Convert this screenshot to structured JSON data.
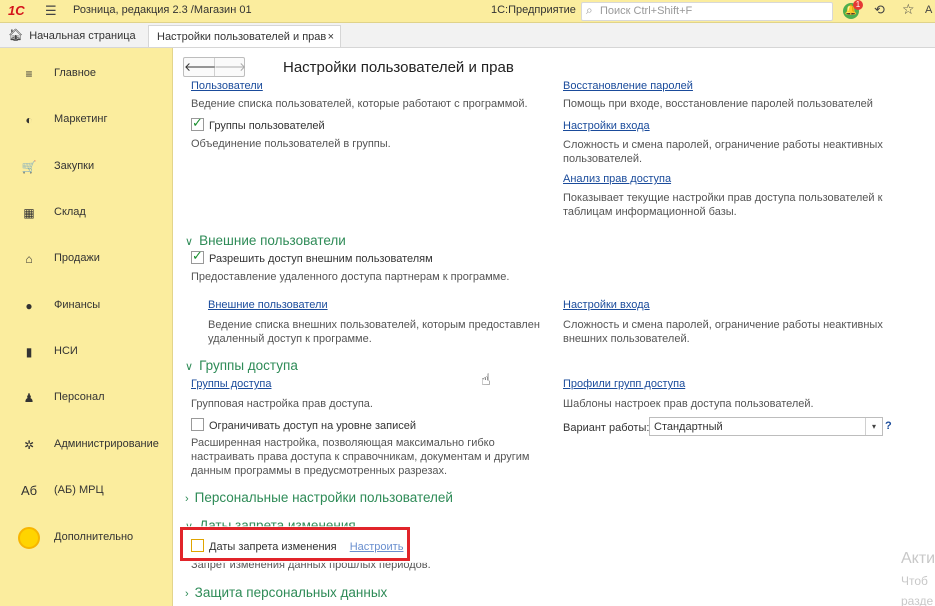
{
  "topbar": {
    "logo": "1С",
    "title": "Розница, редакция 2.3 /Магазин 01",
    "product": "1С:Предприятие",
    "search_placeholder": "Поиск Ctrl+Shift+F",
    "notif_count": "1",
    "user": "А"
  },
  "tabs": {
    "home": "Начальная страница",
    "active": "Настройки пользователей и прав",
    "close": "×"
  },
  "sidebar": {
    "items": [
      {
        "label": "Главное",
        "icon": "menu-icon",
        "glyph": "≡"
      },
      {
        "label": "Маркетинг",
        "icon": "marketing-icon",
        "glyph": "◐"
      },
      {
        "label": "Закупки",
        "icon": "cart-icon",
        "glyph": "🛒"
      },
      {
        "label": "Склад",
        "icon": "warehouse-icon",
        "glyph": "▦"
      },
      {
        "label": "Продажи",
        "icon": "basket-icon",
        "glyph": "⌂"
      },
      {
        "label": "Финансы",
        "icon": "finance-icon",
        "glyph": "●"
      },
      {
        "label": "НСИ",
        "icon": "book-icon",
        "glyph": "▮"
      },
      {
        "label": "Персонал",
        "icon": "person-icon",
        "glyph": "♟"
      },
      {
        "label": "Администрирование",
        "icon": "gear-icon",
        "glyph": "✲"
      },
      {
        "label": "(АБ) МРЦ",
        "icon": "ab-icon",
        "glyph": "Аб"
      },
      {
        "label": "Дополнительно",
        "icon": "sun-icon",
        "glyph": ""
      }
    ]
  },
  "page": {
    "title": "Настройки пользователей и прав",
    "back": "🡐",
    "forward": "🡒"
  },
  "users": {
    "link_users": "Пользователи",
    "users_desc": "Ведение списка пользователей, которые работают с программой.",
    "groups_label": "Группы пользователей",
    "groups_desc": "Объединение пользователей в группы.",
    "link_restore": "Восстановление паролей",
    "restore_desc": "Помощь при входе, восстановление паролей пользователей",
    "link_login": "Настройки входа",
    "login_desc": "Сложность и смена паролей, ограничение работы неактивных пользователей.",
    "link_analysis": "Анализ прав доступа",
    "analysis_desc": "Показывает текущие настройки прав доступа пользователей к таблицам информационной базы."
  },
  "external": {
    "header": "Внешние пользователи",
    "allow_label": "Разрешить доступ внешним пользователям",
    "allow_desc": "Предоставление удаленного доступа партнерам к программе.",
    "link_ext": "Внешние пользователи",
    "ext_desc": "Ведение списка внешних пользователей, которым предоставлен удаленный доступ к программе.",
    "link_login": "Настройки входа",
    "login_desc": "Сложность и смена паролей, ограничение работы неактивных внешних пользователей."
  },
  "access": {
    "header": "Группы доступа",
    "link_groups": "Группы доступа",
    "groups_desc": "Групповая настройка прав доступа.",
    "restrict_label": "Ограничивать доступ на уровне записей",
    "restrict_desc": "Расширенная настройка, позволяющая максимально гибко настраивать права доступа к справочникам, документам и другим данным программы в предусмотренных разрезах.",
    "link_profiles": "Профили групп доступа",
    "profiles_desc": "Шаблоны настроек прав доступа пользователей.",
    "variant_label": "Вариант работы:",
    "variant_value": "Стандартный",
    "help": "?"
  },
  "personal": {
    "header": "Персональные настройки пользователей"
  },
  "closing": {
    "header": "Даты запрета изменения",
    "checkbox_label": "Даты запрета изменения",
    "configure_link": "Настроить",
    "desc": "Запрет изменения данных прошлых периодов."
  },
  "protection": {
    "header": "Защита персональных данных"
  },
  "watermark": {
    "line1": "Акти",
    "line2": "Чтоб",
    "line3": "разде"
  }
}
